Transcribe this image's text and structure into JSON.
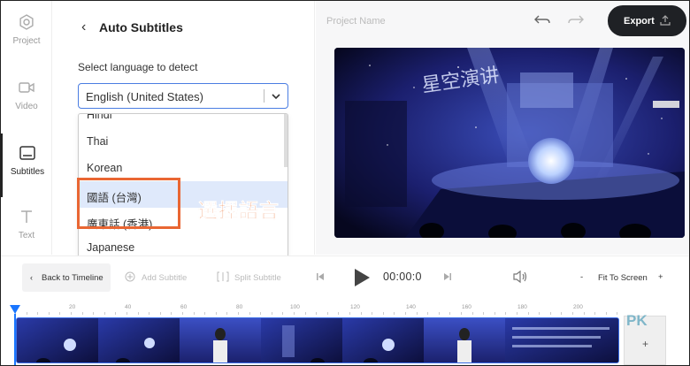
{
  "rail": {
    "items": [
      {
        "label": "Project",
        "icon": "gear-icon"
      },
      {
        "label": "Video",
        "icon": "video-camera-icon"
      },
      {
        "label": "Subtitles",
        "icon": "subtitles-icon"
      },
      {
        "label": "Text",
        "icon": "text-t-icon"
      }
    ]
  },
  "panel": {
    "title": "Auto Subtitles",
    "language_label": "Select language to detect",
    "selected_language": "English (United States)",
    "options": [
      "Hindi",
      "Thai",
      "Korean",
      "國語 (台灣)",
      "廣東話 (香港)",
      "Japanese"
    ],
    "highlighted_option": "國語 (台灣)",
    "callout": "選擇語言"
  },
  "stage": {
    "project_name_placeholder": "Project Name",
    "export_label": "Export",
    "video_text": "星空演讲"
  },
  "timeline": {
    "back_label": "Back to Timeline",
    "add_subtitle_label": "Add Subtitle",
    "split_subtitle_label": "Split Subtitle",
    "time": "00:00:0",
    "zoom_minus": "-",
    "fit_label": "Fit To Screen",
    "zoom_plus": "+",
    "ruler_ticks": [
      "20",
      "40",
      "60",
      "80",
      "100",
      "120",
      "140",
      "160",
      "180",
      "200"
    ],
    "add_track_label": "+",
    "watermark": "PK"
  },
  "colors": {
    "accent": "#4a7de2",
    "highlight_box": "#e96633",
    "export_bg": "#1f2125",
    "playhead": "#1976ff"
  }
}
